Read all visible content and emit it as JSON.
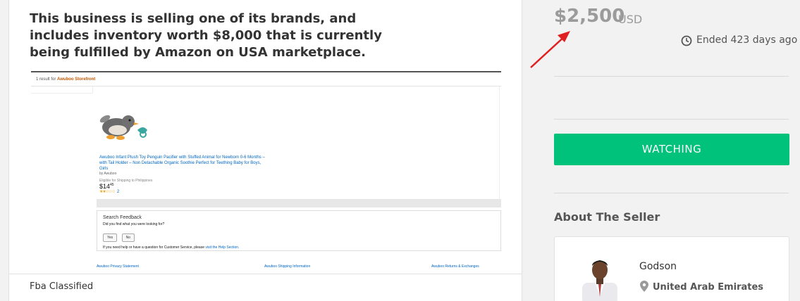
{
  "listing": {
    "headline": "This business is selling one of its brands, and includes inventory worth $8,000 that is currently being fulfilled by Amazon on USA marketplace.",
    "footer_label": "Fba Classified"
  },
  "embedded_screenshot": {
    "result_text": "1 result for",
    "brand_link": "Awuboo Storefront",
    "product_title": "Awuboo Infant Plush Toy Penguin Pacifier with Stuffed Animal for Newborn 0-6 Months – with Tail Holder – Non Detachable Organic Soothie Perfect for Teething Baby for Boys, Girls",
    "by_line": "by Awuboo",
    "eligibility": "Eligible for Shipping to Philippines",
    "price_dollars": "$14",
    "price_cents": "45",
    "stars": "★★☆☆☆",
    "review_count": "2",
    "feedback": {
      "title": "Search Feedback",
      "question": "Did you find what you were looking for?",
      "yes_label": "Yes",
      "no_label": "No",
      "help_text": "If you need help or have a question for Customer Service, please",
      "help_link": "visit the Help Section."
    },
    "footer_links": [
      "Awuboo Privacy Statement",
      "Awuboo Shipping Information",
      "Awuboo Returns & Exchanges"
    ]
  },
  "sidebar": {
    "price": "$2,500",
    "currency": "USD",
    "ended_text": "Ended 423 days ago",
    "watch_button": "WATCHING",
    "about_heading": "About The Seller",
    "seller": {
      "name": "Godson",
      "location": "United Arab Emirates"
    }
  },
  "colors": {
    "accent_green": "#00c27a",
    "annotation_arrow": "#e02020",
    "price_gray": "#9b9b9b"
  }
}
